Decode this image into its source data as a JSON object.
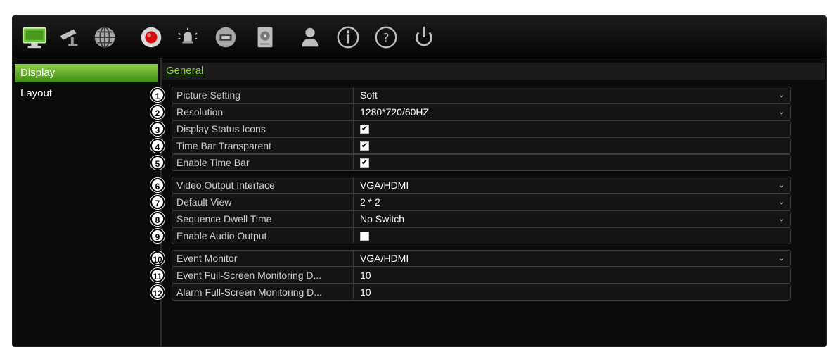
{
  "toolbar": {
    "icons": [
      {
        "name": "display-icon",
        "active": true
      },
      {
        "name": "camera-icon"
      },
      {
        "name": "network-icon"
      },
      {
        "name": "record-icon"
      },
      {
        "name": "alarm-icon"
      },
      {
        "name": "device-icon"
      },
      {
        "name": "storage-icon"
      },
      {
        "name": "user-icon"
      },
      {
        "name": "info-icon"
      },
      {
        "name": "help-icon"
      },
      {
        "name": "power-icon"
      }
    ]
  },
  "sidebar": {
    "items": [
      {
        "label": "Display",
        "active": true
      },
      {
        "label": "Layout",
        "active": false
      }
    ]
  },
  "tabs": [
    {
      "label": "General",
      "active": true
    }
  ],
  "settings": [
    {
      "num": "1",
      "label": "Picture Setting",
      "type": "select",
      "value": "Soft"
    },
    {
      "num": "2",
      "label": "Resolution",
      "type": "select",
      "value": "1280*720/60HZ"
    },
    {
      "num": "3",
      "label": "Display Status Icons",
      "type": "checkbox",
      "checked": true
    },
    {
      "num": "4",
      "label": "Time Bar Transparent",
      "type": "checkbox",
      "checked": true
    },
    {
      "num": "5",
      "label": "Enable Time Bar",
      "type": "checkbox",
      "checked": true
    },
    {
      "num": "6",
      "label": "Video Output Interface",
      "type": "select",
      "value": "VGA/HDMI"
    },
    {
      "num": "7",
      "label": "Default View",
      "type": "select",
      "value": "2 * 2"
    },
    {
      "num": "8",
      "label": "Sequence Dwell Time",
      "type": "select",
      "value": "No Switch"
    },
    {
      "num": "9",
      "label": "Enable Audio Output",
      "type": "checkbox",
      "checked": false
    },
    {
      "num": "10",
      "label": "Event Monitor",
      "type": "select",
      "value": "VGA/HDMI"
    },
    {
      "num": "11",
      "label": "Event Full-Screen Monitoring D...",
      "type": "text",
      "value": "10"
    },
    {
      "num": "12",
      "label": "Alarm Full-Screen Monitoring D...",
      "type": "text",
      "value": "10"
    }
  ],
  "colors": {
    "accent": "#8fd04a",
    "background": "#0b0b0b"
  }
}
